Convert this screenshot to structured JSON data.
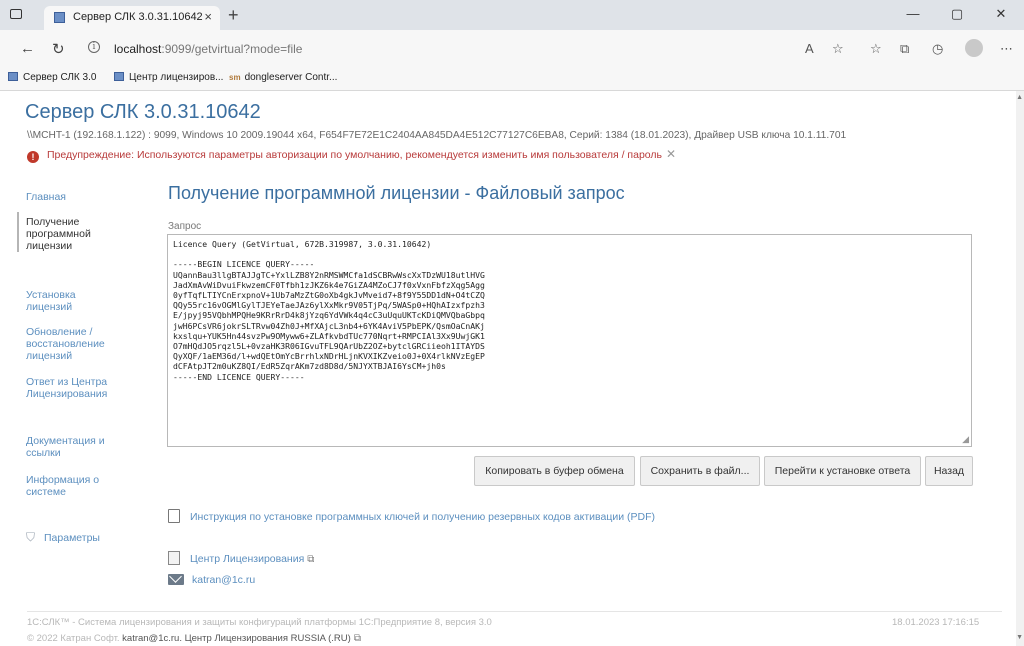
{
  "browser": {
    "tab_title": "Сервер СЛК 3.0.31.10642",
    "tab_close": "×",
    "new_tab": "+",
    "url_host": "localhost",
    "url_rest": ":9099/getvirtual?mode=file",
    "bookmarks": [
      {
        "label": "Сервер СЛК 3.0"
      },
      {
        "label": "Центр лицензиров..."
      },
      {
        "label": "dongleserver Contr..."
      }
    ],
    "window_buttons": [
      "—",
      "▢",
      "✕"
    ]
  },
  "page": {
    "server_title": "Сервер СЛК 3.0.31.10642",
    "server_info": "\\\\MCHT-1 (192.168.1.122) : 9099,  Windows 10 2009.19044 x64,  F654F7E72E1C2404AA845DA4E512C77127C6EBA8,  Серий: 1384 (18.01.2023),  Драйвер USB ключа 10.1.11.701",
    "warning": "Предупреждение: Используются параметры авторизации по умолчанию, рекомендуется изменить имя пользователя / пароль",
    "warning_close": "✕"
  },
  "sidebar": {
    "items": [
      {
        "label": "Главная"
      },
      {
        "label": "Получение программной лицензии"
      },
      {
        "label": "Установка лицензий"
      },
      {
        "label": "Обновление / восстановление лицензий"
      },
      {
        "label": "Ответ из Центра Лицензирования"
      },
      {
        "label": "Документация и ссылки"
      },
      {
        "label": "Информация о системе"
      }
    ],
    "settings_label": "Параметры"
  },
  "main": {
    "title": "Получение программной лицензии - Файловый запрос",
    "request_label": "Запрос",
    "request_text": "Licence Query (GetVirtual, 672B.319987, 3.0.31.10642)\n\n-----BEGIN LICENCE QUERY-----\nUQannBau3llgBTAJJgTC+YxlLZB8Y2nRMSWMCfa1dSCBRwWscXxTDzWU18utlHVG\nJadXmAvWiDvuiFkwzemCF0Tfbh1zJKZ6k4e7GiZA4MZoCJ7f0xVxnFbfzXqg5Agg\n0yfTqfLTIYCnErxpnoV+1Ub7aMzZtG0oXb4gkJvMveid7+8f9Y55DD1dN+O4tCZQ\nQQy55rc16vOGMlGylTJEYeTaeJAz6ylXxMkr9V05TjPq/5WASp0+HQhAIzxfpzh3\nE/jpyj95VQbhMPQHe9KRrRrD4k8jYzq6YdVWk4q4cC3uUquUKTcKDiQMVQbaGbpq\njwH6PCsVR6jokrSLTRvw04Zh0J+MfXAjcL3nb4+6YK4AviV5PbEPK/QsmOaCnAKj\nkxslqu+YUK5Hn44svzPw9OMyww6+ZLAfkvbdTUc770Nqrt+RMPCIAl3Xx9UwjGK1\nO7mHQdJO5rqzl5L+0vzaHK3R06IGvuTFL9QArUbZ2OZ+bytclGRCiieoh1ITAYDS\nQyXQF/1aEM36d/l+wdQEtOmYcBrrhlxNDrHLjnKVXIKZveio0J+0X4rlkNVzEgEP\ndCFAtpJT2m0uKZ8QI/EdR5ZqrAKm7zd8D8d/5NJYXTBJAI6YsCM+jh0s\n-----END LICENCE QUERY-----",
    "buttons": {
      "copy": "Копировать в буфер обмена",
      "save": "Сохранить в файл...",
      "goto_install": "Перейти к установке ответа",
      "back": "Назад"
    },
    "links": {
      "instruction": "Инструкция по установке программных ключей и получению резервных кодов активации (PDF)",
      "license_center": "Центр Лицензирования",
      "email": "katran@1c.ru"
    }
  },
  "footer": {
    "line1": "1С:СЛК™ - Система лицензирования и защиты конфигураций платформы 1С:Предприятие 8, версия 3.0",
    "timestamp": "18.01.2023 17:16:15",
    "copyright": "© 2022 Катран Софт.",
    "email": "katran@1c.ru",
    "center": "Центр Лицензирования RUSSIA (.RU)"
  },
  "icons": {
    "warning": "warning-icon",
    "settings": "shield-gear-icon",
    "pdf": "pdf-icon",
    "external": "external-link-icon",
    "mail": "mail-icon"
  },
  "colors": {
    "accent": "#3b6fa0",
    "link": "#5c8fbf",
    "warning": "#b83a3a"
  }
}
